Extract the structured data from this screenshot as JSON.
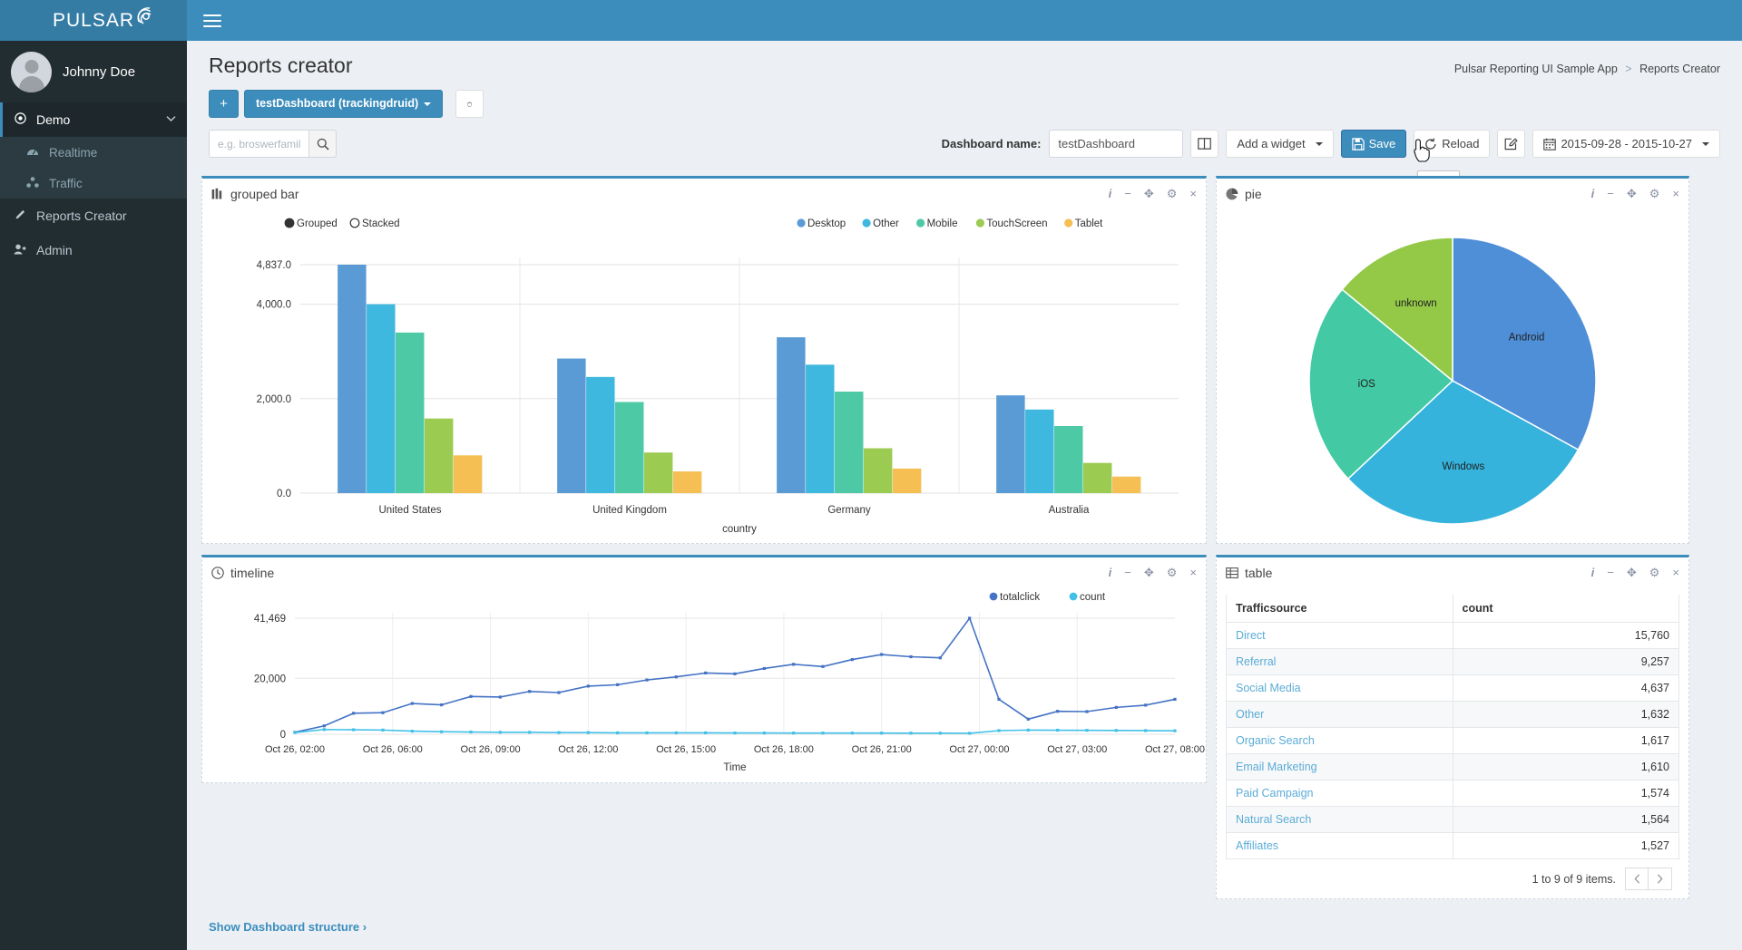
{
  "brand": {
    "name": "PULSAR",
    "logo_icon": "radar-icon"
  },
  "sidebar": {
    "user": {
      "name": "Johnny Doe",
      "avatar_icon": "user-avatar-icon"
    },
    "items": [
      {
        "label": "Demo",
        "icon": "target-icon",
        "chevron": "chevron-down-icon",
        "active": true
      },
      {
        "label": "Realtime",
        "icon": "dashboard-icon",
        "sub": true
      },
      {
        "label": "Traffic",
        "icon": "sitemap-icon",
        "sub": true
      },
      {
        "label": "Reports Creator",
        "icon": "pencil-icon"
      },
      {
        "label": "Admin",
        "icon": "user-plus-icon"
      }
    ]
  },
  "topbar": {
    "menu_toggle_icon": "hamburger-icon"
  },
  "header": {
    "title": "Reports creator",
    "breadcrumb": {
      "root": "Pulsar Reporting UI Sample App",
      "separator": ">",
      "current": "Reports Creator"
    }
  },
  "dashboard_bar": {
    "add_label": "+",
    "selected_dashboard": "testDashboard (trackingdruid)",
    "delete_icon": "trash-icon"
  },
  "filter": {
    "placeholder": "e.g. broswerfamily = 'Chrome'",
    "value": "",
    "search_icon": "search-icon"
  },
  "toolbar": {
    "dashboard_name_label": "Dashboard name:",
    "dashboard_name_value": "testDashboard",
    "layout_icon": "columns-icon",
    "add_widget_label": "Add a widget",
    "save_label": "Save",
    "save_icon": "floppy-icon",
    "reload_label": "Reload",
    "reload_icon": "refresh-icon",
    "edit_icon": "edit-square-icon",
    "date_range_label": "2015-09-28 - 2015-10-27",
    "calendar_icon": "calendar-icon",
    "save_tooltip": "Save"
  },
  "widgets": {
    "controls": {
      "info": "i",
      "minimize": "−",
      "move": "✥",
      "settings": "⚙",
      "close": "×"
    },
    "grouped_bar": {
      "title": "grouped bar",
      "icon": "bar-chart-icon"
    },
    "pie": {
      "title": "pie",
      "icon": "pie-chart-icon"
    },
    "timeline": {
      "title": "timeline",
      "icon": "clock-icon"
    },
    "table": {
      "title": "table",
      "icon": "table-icon"
    }
  },
  "table_widget": {
    "columns": [
      "Trafficsource",
      "count"
    ],
    "rows": [
      {
        "source": "Direct",
        "count": "15,760"
      },
      {
        "source": "Referral",
        "count": "9,257"
      },
      {
        "source": "Social Media",
        "count": "4,637"
      },
      {
        "source": "Other",
        "count": "1,632"
      },
      {
        "source": "Organic Search",
        "count": "1,617"
      },
      {
        "source": "Email Marketing",
        "count": "1,610"
      },
      {
        "source": "Paid Campaign",
        "count": "1,574"
      },
      {
        "source": "Natural Search",
        "count": "1,564"
      },
      {
        "source": "Affiliates",
        "count": "1,527"
      }
    ],
    "footer_text": "1 to 9 of 9 items.",
    "prev_icon": "chevron-left-icon",
    "next_icon": "chevron-right-icon"
  },
  "footer": {
    "structure_link": "Show Dashboard structure ›"
  },
  "chart_data": [
    {
      "type": "bar",
      "title": "grouped bar",
      "mode_options": [
        "Grouped",
        "Stacked"
      ],
      "mode_selected": "Grouped",
      "categories": [
        "United States",
        "United Kingdom",
        "Germany",
        "Australia"
      ],
      "series": [
        {
          "name": "Desktop",
          "color": "#5b9bd5",
          "values": [
            4837,
            2850,
            3300,
            2070
          ]
        },
        {
          "name": "Other",
          "color": "#3eb8de",
          "values": [
            4000,
            2460,
            2720,
            1770
          ]
        },
        {
          "name": "Mobile",
          "color": "#4ec9a6",
          "values": [
            3400,
            1930,
            2150,
            1420
          ]
        },
        {
          "name": "TouchScreen",
          "color": "#9ccb52",
          "values": [
            1580,
            860,
            950,
            640
          ]
        },
        {
          "name": "Tablet",
          "color": "#f5bf54",
          "values": [
            800,
            460,
            520,
            350
          ]
        }
      ],
      "xlabel": "country",
      "ylabel": "",
      "ylim": [
        0,
        4837
      ],
      "yticks": [
        "0.0",
        "2,000.0",
        "4,000.0",
        "4,837.0"
      ],
      "grid": true,
      "legend_position": "top-right"
    },
    {
      "type": "pie",
      "title": "pie",
      "labels": [
        "Android",
        "Windows",
        "iOS",
        "unknown"
      ],
      "values": [
        33,
        30,
        23,
        14
      ],
      "colors": [
        "#4e8fd8",
        "#35b3dd",
        "#43c9a3",
        "#94c948"
      ]
    },
    {
      "type": "line",
      "title": "timeline",
      "xlabel": "Time",
      "ylabel": "",
      "yticks": [
        "0",
        "20,000",
        "41,469"
      ],
      "ylim": [
        0,
        41469
      ],
      "xticks": [
        "Oct 26, 02:00",
        "Oct 26, 06:00",
        "Oct 26, 09:00",
        "Oct 26, 12:00",
        "Oct 26, 15:00",
        "Oct 26, 18:00",
        "Oct 26, 21:00",
        "Oct 27, 00:00",
        "Oct 27, 03:00",
        "Oct 27, 08:00"
      ],
      "series": [
        {
          "name": "totalclick",
          "color": "#4472c4",
          "values": [
            700,
            3000,
            7500,
            7700,
            11000,
            10500,
            13500,
            13300,
            15300,
            14900,
            17200,
            17700,
            19400,
            20500,
            21900,
            21600,
            23500,
            25000,
            24200,
            26700,
            28500,
            27700,
            27300,
            41469,
            12500,
            5400,
            8200,
            8100,
            9600,
            10400,
            12500
          ]
        },
        {
          "name": "count",
          "color": "#41c0e8",
          "values": [
            600,
            1700,
            1600,
            1500,
            1100,
            900,
            800,
            700,
            700,
            600,
            600,
            500,
            500,
            500,
            500,
            450,
            450,
            430,
            430,
            420,
            410,
            400,
            380,
            350,
            1300,
            1500,
            1450,
            1400,
            1350,
            1300,
            1250
          ]
        }
      ],
      "legend_position": "top-right",
      "grid": true
    }
  ]
}
